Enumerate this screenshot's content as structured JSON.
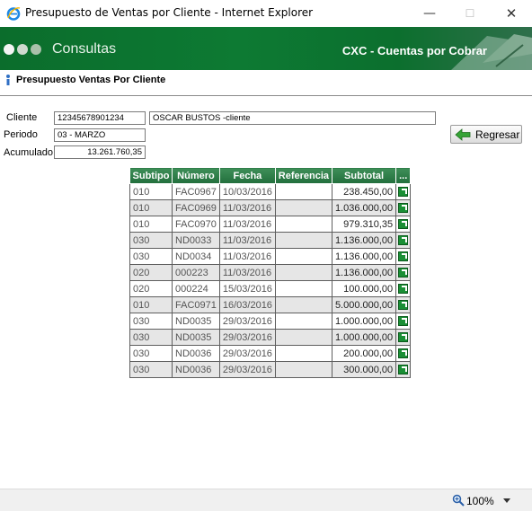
{
  "window": {
    "title": "Presupuesto de Ventas por Cliente - Internet Explorer",
    "minimize_glyph": "—",
    "maximize_glyph": "☐",
    "close_glyph": "✕"
  },
  "banner": {
    "app_title": "Consultas",
    "module_title": "CXC - Cuentas por Cobrar"
  },
  "page": {
    "heading": "Presupuesto Ventas Por Cliente"
  },
  "form": {
    "cliente_label": "Cliente",
    "cliente_code": "12345678901234",
    "cliente_name": "OSCAR BUSTOS -cliente",
    "periodo_label": "Periodo",
    "periodo_value": "03 - MARZO",
    "acumulado_label": "Acumulado",
    "acumulado_value": "13.261.760,35"
  },
  "buttons": {
    "regresar": "Regresar"
  },
  "table": {
    "headers": [
      "Subtipo",
      "Número",
      "Fecha",
      "Referencia",
      "Subtotal",
      "..."
    ],
    "rows": [
      [
        "010",
        "FAC0967",
        "10/03/2016",
        "",
        "238.450,00"
      ],
      [
        "010",
        "FAC0969",
        "11/03/2016",
        "",
        "1.036.000,00"
      ],
      [
        "010",
        "FAC0970",
        "11/03/2016",
        "",
        "979.310,35"
      ],
      [
        "030",
        "ND0033",
        "11/03/2016",
        "",
        "1.136.000,00"
      ],
      [
        "030",
        "ND0034",
        "11/03/2016",
        "",
        "1.136.000,00"
      ],
      [
        "020",
        "000223",
        "11/03/2016",
        "",
        "1.136.000,00"
      ],
      [
        "020",
        "000224",
        "15/03/2016",
        "",
        "100.000,00"
      ],
      [
        "010",
        "FAC0971",
        "16/03/2016",
        "",
        "5.000.000,00"
      ],
      [
        "030",
        "ND0035",
        "29/03/2016",
        "",
        "1.000.000,00"
      ],
      [
        "030",
        "ND0035",
        "29/03/2016",
        "",
        "1.000.000,00"
      ],
      [
        "030",
        "ND0036",
        "29/03/2016",
        "",
        "200.000,00"
      ],
      [
        "030",
        "ND0036",
        "29/03/2016",
        "",
        "300.000,00"
      ]
    ]
  },
  "status": {
    "zoom": "100%"
  },
  "colors": {
    "banner_green": "#0d7a33",
    "header_green": "#226e3c"
  },
  "icons": {
    "browser": "internet-explorer-icon",
    "info": "info-icon",
    "back": "green-left-arrow-icon",
    "row_action": "go-arrow-icon",
    "zoom": "magnifier-icon"
  }
}
